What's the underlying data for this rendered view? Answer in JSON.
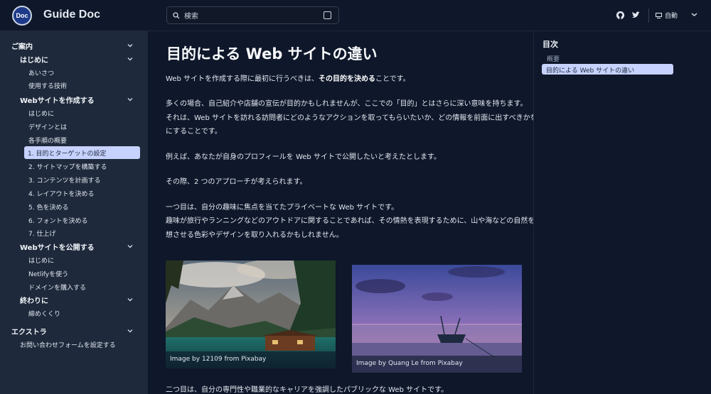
{
  "header": {
    "logo_text": "Doc",
    "site_title": "Guide Doc",
    "search_placeholder": "検索",
    "theme_label": "自動"
  },
  "sidebar": {
    "sections": [
      {
        "label": "ご案内"
      },
      {
        "label": "はじめに"
      },
      {
        "label": "Webサイトを作成する"
      },
      {
        "label": "Webサイトを公開する"
      },
      {
        "label": "終わりに"
      },
      {
        "label": "エクストラ"
      }
    ],
    "items": {
      "aisatsu": "あいさつ",
      "tech": "使用する技術",
      "hajimeni2": "はじめに",
      "design": "デザインとは",
      "steps": "各手順の概要",
      "s1": "1. 目的とターゲットの設定",
      "s2": "2. サイトマップを構築する",
      "s3": "3. コンテンツを計画する",
      "s4": "4. レイアウトを決める",
      "s5": "5. 色を決める",
      "s6": "6. フォントを決める",
      "s7": "7. 仕上げ",
      "hajimeni3": "はじめに",
      "netlify": "Netlifyを使う",
      "domain": "ドメインを購入する",
      "shimekukuri": "締めくくり",
      "form": "お問い合わせフォームを設定する"
    }
  },
  "main": {
    "title": "目的による Web サイトの違い",
    "p1a": "Web サイトを作成する際に最初に行うべきは、",
    "p1b": "その目的を決める",
    "p1c": "ことです。",
    "p2": "多くの場合、自己紹介や店舗の宣伝が目的かもしれませんが、ここでの「目的」とはさらに深い意味を持ちます。",
    "p3": "それは、Web サイトを訪れる訪問者にどのようなアクションを取ってもらいたいか、どの情報を前面に出すべきかを明確",
    "p4": "にすることです。",
    "p5": "例えば、あなたが自身のプロフィールを Web サイトで公開したいと考えたとします。",
    "p6": "その際、2 つのアプローチが考えられます。",
    "p7": "一つ目は、自分の趣味に焦点を当てたプライベートな Web サイトです。",
    "p8": "趣味が旅行やランニングなどのアウトドアに関することであれば、その情熱を表現するために、山や海などの自然を連",
    "p9": "想させる色彩やデザインを取り入れるかもしれません。",
    "img1_caption": "Image by 12109 from Pixabay",
    "img2_caption": "Image by Quang Le from Pixabay",
    "p10": "二つ目は、自分の専門性や職業的なキャリアを強調したパブリックな Web サイトです。"
  },
  "toc": {
    "title": "目次",
    "items": [
      "概要",
      "目的による Web サイトの違い"
    ]
  }
}
